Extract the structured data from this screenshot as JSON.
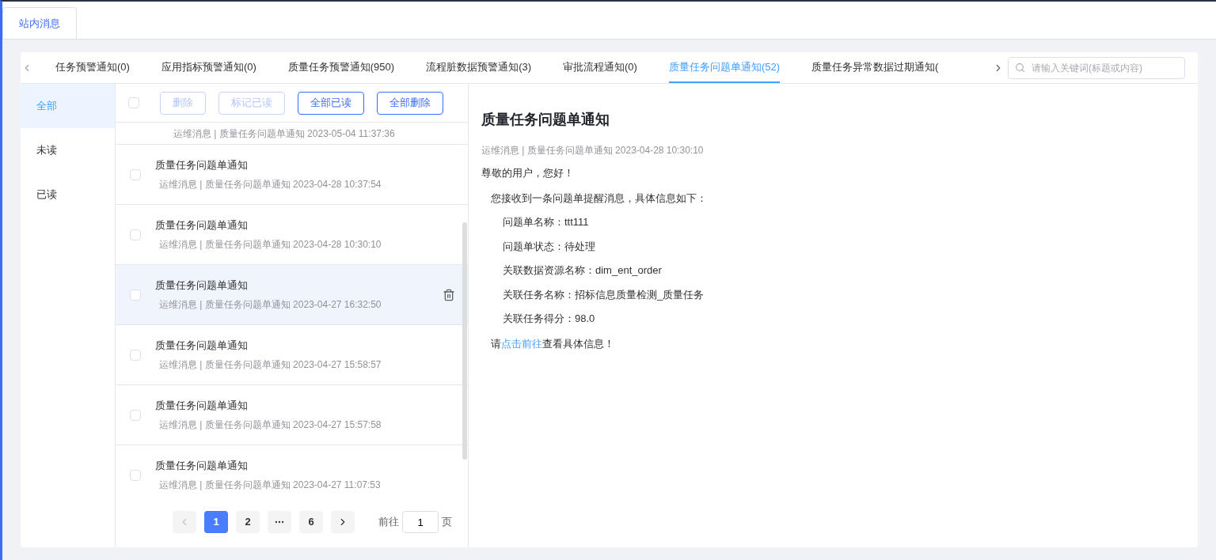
{
  "top_tabs": [
    {
      "label": "站内消息",
      "selected": true
    }
  ],
  "category_tabs": [
    {
      "label": "任务预警通知(0)",
      "selected": false
    },
    {
      "label": "应用指标预警通知(0)",
      "selected": false
    },
    {
      "label": "质量任务预警通知(950)",
      "selected": false
    },
    {
      "label": "流程脏数据预警通知(3)",
      "selected": false
    },
    {
      "label": "审批流程通知(0)",
      "selected": false
    },
    {
      "label": "质量任务问题单通知(52)",
      "selected": true
    },
    {
      "label": "质量任务异常数据过期通知(",
      "selected": false
    }
  ],
  "search": {
    "placeholder": "请输入关键词(标题或内容)"
  },
  "filters": [
    {
      "label": "全部",
      "selected": true
    },
    {
      "label": "未读",
      "selected": false
    },
    {
      "label": "已读",
      "selected": false
    }
  ],
  "toolbar": {
    "select_all_checked": false,
    "buttons": [
      {
        "label": "删除",
        "disabled": true
      },
      {
        "label": "标记已读",
        "disabled": true
      },
      {
        "label": "全部已读",
        "disabled": false
      },
      {
        "label": "全部删除",
        "disabled": false
      }
    ]
  },
  "messages": [
    {
      "meta": "运维消息 | 质量任务问题单通知 2023-05-04 11:37:36",
      "selected": false
    },
    {
      "title": "质量任务问题单通知",
      "meta": "运维消息 | 质量任务问题单通知 2023-04-28 10:37:54",
      "checked": false,
      "selected": false
    },
    {
      "title": "质量任务问题单通知",
      "meta": "运维消息 | 质量任务问题单通知 2023-04-28 10:30:10",
      "checked": false,
      "selected": false
    },
    {
      "title": "质量任务问题单通知",
      "meta": "运维消息 | 质量任务问题单通知 2023-04-27 16:32:50",
      "checked": false,
      "selected": true
    },
    {
      "title": "质量任务问题单通知",
      "meta": "运维消息 | 质量任务问题单通知 2023-04-27 15:58:57",
      "checked": false,
      "selected": false
    },
    {
      "title": "质量任务问题单通知",
      "meta": "运维消息 | 质量任务问题单通知 2023-04-27 15:57:58",
      "checked": false,
      "selected": false
    },
    {
      "title": "质量任务问题单通知",
      "meta": "运维消息 | 质量任务问题单通知 2023-04-27 11:07:53",
      "checked": false,
      "selected": false
    }
  ],
  "pagination": {
    "prev_disabled": true,
    "next_disabled": false,
    "pages": [
      {
        "kind": "page",
        "label": "1",
        "selected": true
      },
      {
        "kind": "page",
        "label": "2",
        "selected": false
      },
      {
        "kind": "more",
        "selected": false
      },
      {
        "kind": "page",
        "label": "6",
        "selected": false
      }
    ],
    "goto_label": "前往",
    "goto_value": "1",
    "goto_suffix": "页"
  },
  "detail": {
    "title": "质量任务问题单通知",
    "meta": "运维消息 | 质量任务问题单通知 2023-04-28 10:30:10",
    "greeting": "尊敬的用户，您好！",
    "intro": "您接收到一条问题单提醒消息，具体信息如下：",
    "fields": [
      {
        "label": "问题单名称：",
        "value": "ttt111"
      },
      {
        "label": "问题单状态：",
        "value": "待处理"
      },
      {
        "label": "关联数据资源名称：",
        "value": "dim_ent_order"
      },
      {
        "label": "关联任务名称：",
        "value": "招标信息质量检测_质量任务"
      },
      {
        "label": "关联任务得分：",
        "value": "98.0"
      }
    ],
    "closing_before": "请",
    "closing_link": "点击前往",
    "closing_after": "查看具体信息！"
  }
}
